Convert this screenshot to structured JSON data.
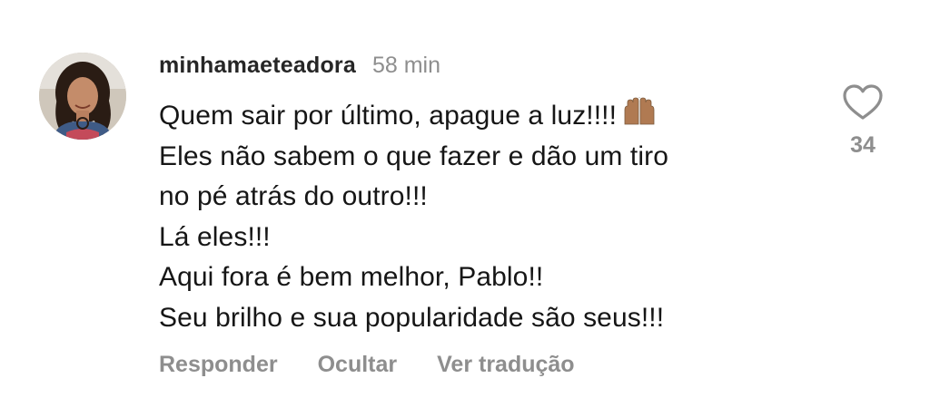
{
  "comment": {
    "username": "minhamaeteadora",
    "time": "58 min",
    "body_lines": [
      "Quem sair por último, apague a luz!!!!",
      "Eles não sabem o que fazer e dão um tiro",
      "no pé atrás do outro!!!",
      "Lá eles!!!",
      "Aqui fora é bem melhor, Pablo!!",
      "Seu brilho e sua popularidade são seus!!!"
    ],
    "emoji": "raising-hands-icon",
    "actions": {
      "reply": "Responder",
      "hide": "Ocultar",
      "translate": "Ver tradução"
    },
    "likes": "34"
  },
  "colors": {
    "username": "#262626",
    "secondary": "#8e8e8e",
    "text": "#161616",
    "background": "#ffffff"
  }
}
